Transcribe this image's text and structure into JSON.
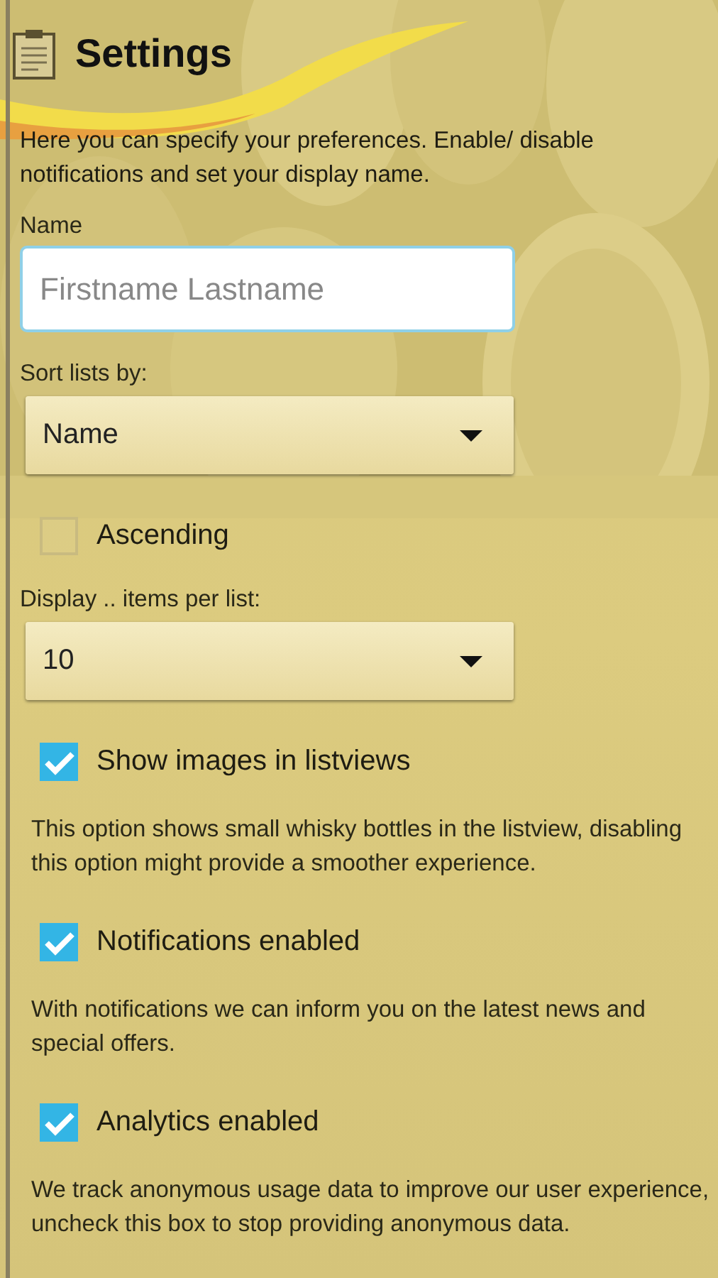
{
  "header": {
    "title": "Settings"
  },
  "intro": "Here you can specify your preferences. Enable/ disable notifications and set your display name.",
  "name_field": {
    "label": "Name",
    "placeholder": "Firstname Lastname"
  },
  "sort": {
    "label": "Sort lists by:",
    "value": "Name"
  },
  "ascending": {
    "label": "Ascending",
    "checked": false
  },
  "display": {
    "label": "Display .. items per list:",
    "value": "10"
  },
  "options": [
    {
      "label": "Show images in listviews",
      "checked": true,
      "description": "This option shows small whisky bottles in the listview, disabling this option might provide a smoother experience."
    },
    {
      "label": "Notifications enabled",
      "checked": true,
      "description": "With notifications we can inform you on the latest news and special offers."
    },
    {
      "label": "Analytics enabled",
      "checked": true,
      "description": "We track anonymous usage data to improve our user experience, uncheck this box to stop providing anonymous data."
    }
  ]
}
